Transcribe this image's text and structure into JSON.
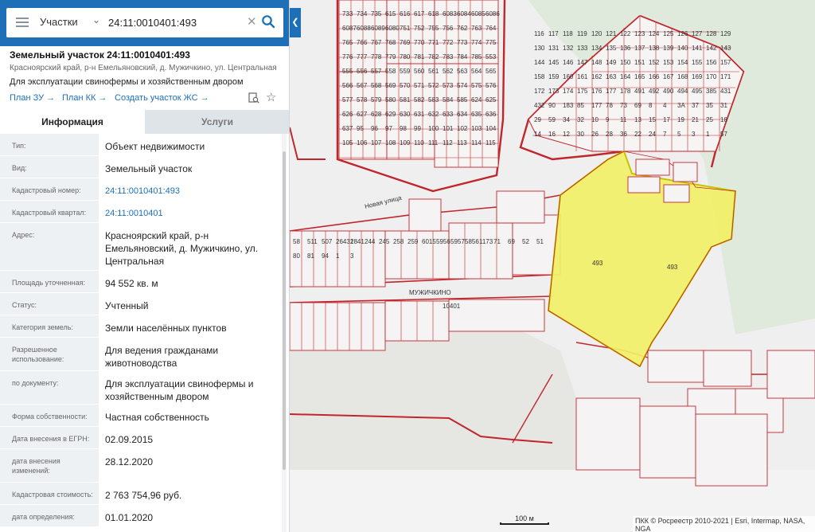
{
  "search": {
    "layer": "Участки",
    "query": "24:11:0010401:493"
  },
  "card": {
    "title": "Земельный участок 24:11:0010401:493",
    "address_short": "Красноярский край, р-н Емельяновский, д. Мужичкино, ул. Центральная",
    "purpose": "Для эксплуатации свинофермы и хозяйственным двором",
    "links": {
      "plan_zu": "План ЗУ",
      "plan_kk": "План КК",
      "create": "Создать участок ЖС"
    }
  },
  "tabs": {
    "info": "Информация",
    "services": "Услуги"
  },
  "rows": [
    {
      "label": "Тип:",
      "value": "Объект недвижимости"
    },
    {
      "label": "Вид:",
      "value": "Земельный участок"
    },
    {
      "label": "Кадастровый номер:",
      "value": "24:11:0010401:493"
    },
    {
      "label": "Кадастровый квартал:",
      "value": "24:11:0010401"
    },
    {
      "label": "Адрес:",
      "value": "Красноярский край, р-н Емельяновский, д. Мужичкино, ул. Центральная"
    },
    {
      "label": "Площадь уточненная:",
      "value": "94 552 кв. м"
    },
    {
      "label": "Статус:",
      "value": "Учтенный"
    },
    {
      "label": "Категория земель:",
      "value": "Земли населённых пунктов"
    },
    {
      "label": "Разрешенное использование:",
      "value": "Для ведения гражданами животноводства"
    },
    {
      "label": "по документу:",
      "value": "Для эксплуатации свинофермы и хозяйственным двором"
    },
    {
      "label": "Форма собственности:",
      "value": "Частная собственность"
    },
    {
      "label": "Дата внесения в ЕГРН:",
      "value": "02.09.2015"
    },
    {
      "label": "дата внесения изменений:",
      "value": "28.12.2020"
    },
    {
      "label": "Кадастровая стоимость:",
      "value": "2 763 754,96 руб."
    },
    {
      "label": "дата определения:",
      "value": "01.01.2020"
    }
  ],
  "map": {
    "village": "МУЖИЧКИНО",
    "street": "Новая улица",
    "quarter": "10401",
    "selected_parcel": "493",
    "parcel_labels": [
      "733",
      "734",
      "735",
      "615",
      "616",
      "617",
      "618",
      "6083",
      "6084",
      "6085",
      "6086",
      "6087",
      "6088",
      "6089",
      "6080",
      "751",
      "752",
      "755",
      "756",
      "762",
      "763",
      "764",
      "765",
      "766",
      "767",
      "768",
      "769",
      "770",
      "771",
      "772",
      "773",
      "774",
      "775",
      "776",
      "777",
      "778",
      "779",
      "780",
      "781",
      "782",
      "783",
      "784",
      "785",
      "553",
      "555",
      "556",
      "557",
      "558",
      "559",
      "560",
      "561",
      "562",
      "563",
      "564",
      "565",
      "566",
      "567",
      "568",
      "569",
      "570",
      "571",
      "572",
      "573",
      "574",
      "575",
      "576",
      "577",
      "578",
      "579",
      "580",
      "581",
      "582",
      "583",
      "584",
      "585",
      "624",
      "625",
      "626",
      "627",
      "628",
      "629",
      "630",
      "631",
      "632",
      "633",
      "634",
      "635",
      "636",
      "637",
      "95",
      "96",
      "97",
      "98",
      "99",
      "100",
      "101",
      "102",
      "103",
      "104",
      "105",
      "106",
      "107",
      "108",
      "109",
      "110",
      "111",
      "112",
      "113",
      "114",
      "115",
      "116",
      "117",
      "118",
      "119",
      "120",
      "121",
      "122",
      "123",
      "124",
      "125",
      "126",
      "127",
      "128",
      "129",
      "130",
      "131",
      "132",
      "133",
      "134",
      "135",
      "136",
      "137",
      "138",
      "139",
      "140",
      "141",
      "142",
      "143",
      "144",
      "145",
      "146",
      "147",
      "148",
      "149",
      "150",
      "151",
      "152",
      "153",
      "154",
      "155",
      "156",
      "157",
      "158",
      "159",
      "160",
      "161",
      "162",
      "163",
      "164",
      "165",
      "166",
      "167",
      "168",
      "169",
      "170",
      "171",
      "172",
      "173",
      "174",
      "175",
      "176",
      "177",
      "178",
      "491",
      "492",
      "490",
      "494",
      "495",
      "385",
      "431",
      "432",
      "90",
      "183",
      "85",
      "177",
      "78",
      "73",
      "69",
      "8",
      "4",
      "3А",
      "37",
      "35",
      "31",
      "29",
      "59",
      "34",
      "32",
      "10",
      "9",
      "11",
      "13",
      "15",
      "17",
      "19",
      "21",
      "25",
      "18",
      "14",
      "16",
      "12",
      "30",
      "26",
      "28",
      "36",
      "22",
      "24",
      "7",
      "5",
      "3",
      "1",
      "57",
      "58",
      "511",
      "507",
      "26431",
      "2841",
      "244",
      "245",
      "258",
      "259",
      "6015",
      "5956",
      "5957",
      "5856",
      "1173",
      "71",
      "69",
      "52",
      "51",
      "80",
      "81",
      "94",
      "1",
      "3"
    ],
    "scale": "100 м",
    "attribution": "ПКК © Росреестр 2010-2021 | Esri, Intermap, NASA, NGA"
  },
  "colors": {
    "accent": "#1d6fb8",
    "parcel_line": "#c0262c",
    "selected_fill": "#f2ef64",
    "selected_border": "#c9c200"
  }
}
